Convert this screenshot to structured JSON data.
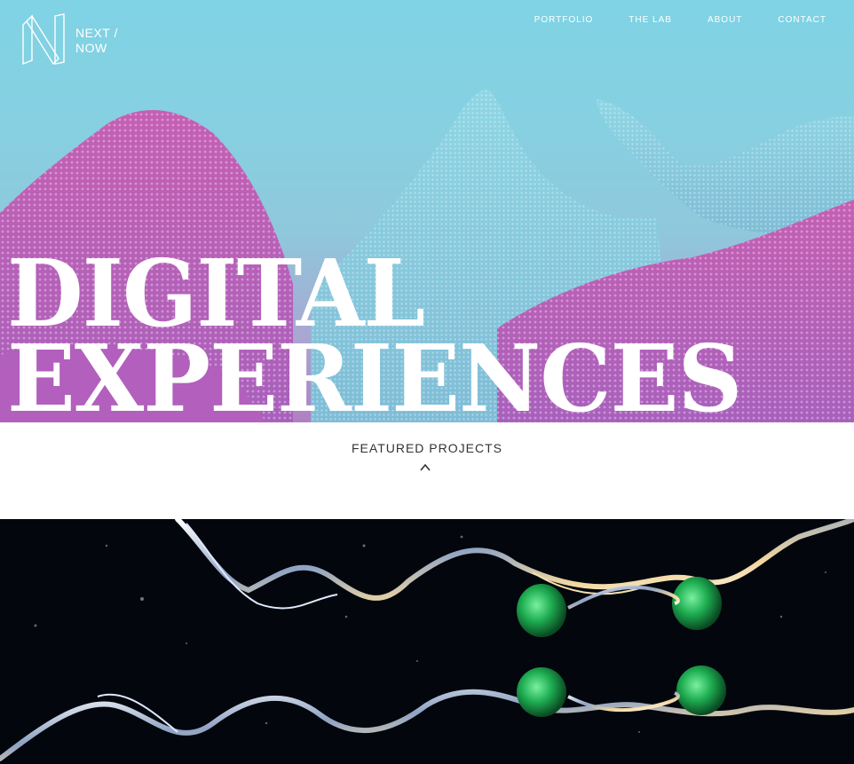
{
  "brand": {
    "line1": "NEXT  /",
    "line2": "NOW"
  },
  "nav": {
    "items": [
      "PORTFOLIO",
      "THE LAB",
      "ABOUT",
      "CONTACT"
    ]
  },
  "hero": {
    "line1": "DIGITAL",
    "line2": "EXPERIENCES"
  },
  "featured": {
    "label": "FEATURED PROJECTS"
  },
  "colors": {
    "sky": "#7fd3e4",
    "magenta": "#b062b8",
    "ink": "#333333",
    "project_bg": "#03070d",
    "green": "#1fae52"
  },
  "icons": {
    "logo": "n-monogram-icon",
    "scroll": "chevron-up-icon"
  }
}
